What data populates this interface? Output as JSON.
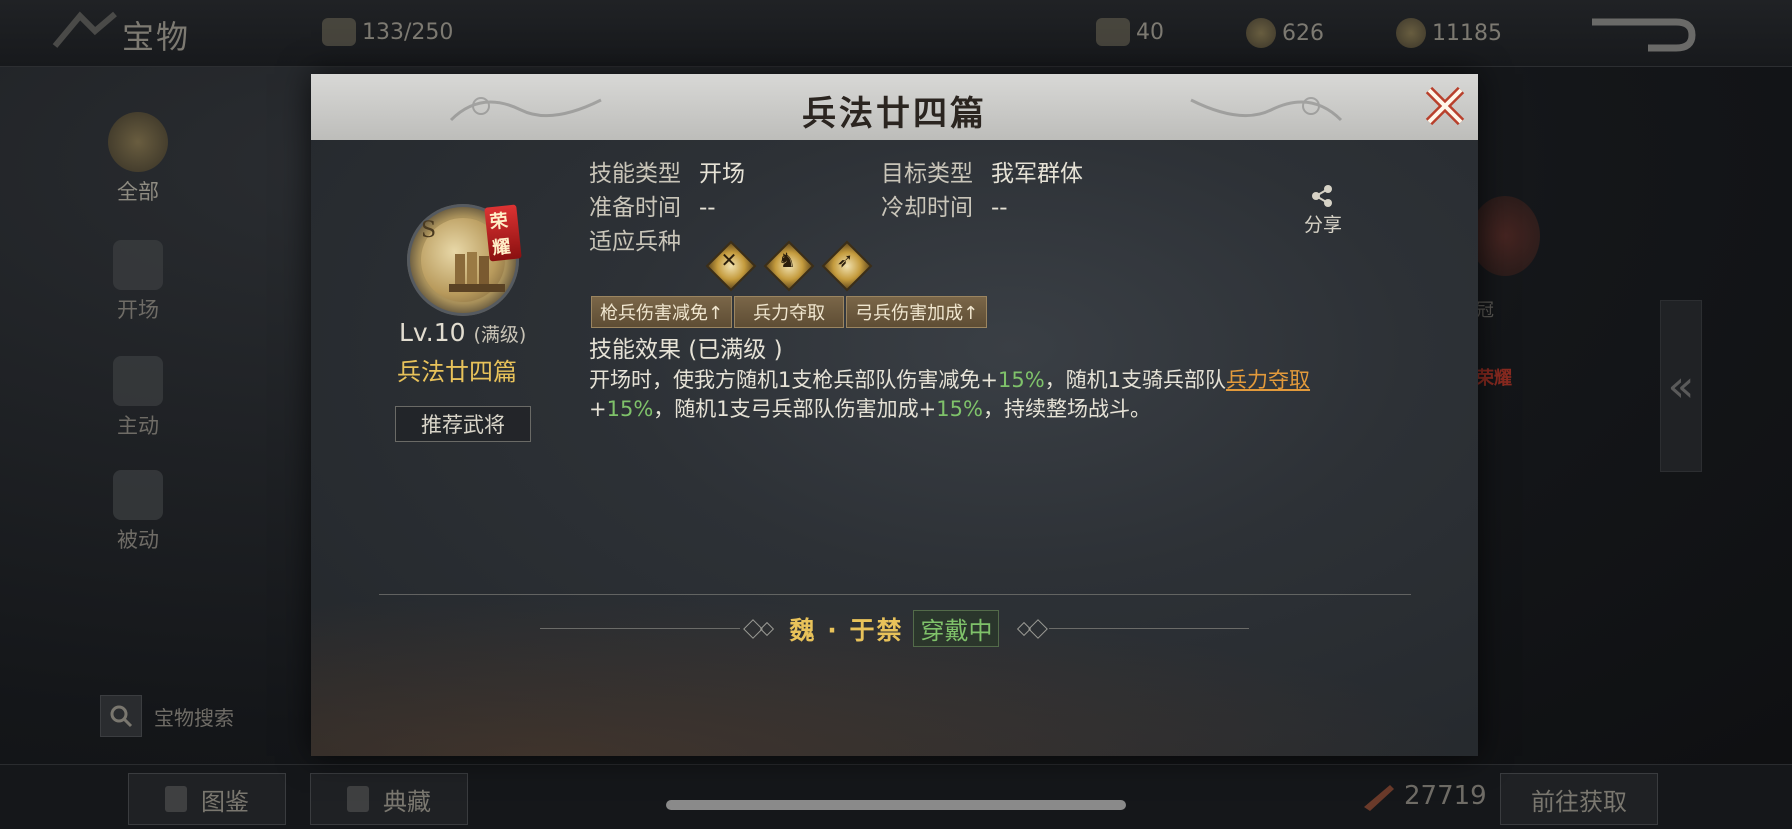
{
  "topbar": {
    "title": "宝物",
    "capacity": "133/250",
    "res1": "40",
    "res2": "626",
    "res3": "11185"
  },
  "sidebar": {
    "items": [
      {
        "label": "全部"
      },
      {
        "label": "开场"
      },
      {
        "label": "主动"
      },
      {
        "label": "被动"
      }
    ],
    "search_label": "宝物搜索"
  },
  "bottombar": {
    "btn_catalog": "图鉴",
    "btn_collection": "典藏",
    "count": "27719",
    "btn_goto": "前往获取"
  },
  "background": {
    "ghost_text_1": "冠",
    "ghost_glory": "荣耀"
  },
  "modal": {
    "title": "兵法廿四篇",
    "skill": {
      "grade": "S",
      "glory_badge": "荣耀",
      "level": "Lv.10",
      "level_note": "(满级)",
      "name": "兵法廿四篇",
      "recommend_label": "推荐武将"
    },
    "attrs": {
      "skill_type_key": "技能类型",
      "skill_type_val": "开场",
      "target_type_key": "目标类型",
      "target_type_val": "我军群体",
      "prep_time_key": "准备时间",
      "prep_time_val": "--",
      "cooldown_key": "冷却时间",
      "cooldown_val": "--",
      "troop_key": "适应兵种"
    },
    "share_label": "分享",
    "troops": [
      {
        "icon": "spear-icon"
      },
      {
        "icon": "horse-icon"
      },
      {
        "icon": "bow-icon"
      }
    ],
    "tags": [
      "枪兵伤害减免↑",
      "兵力夺取",
      "弓兵伤害加成↑"
    ],
    "effect_title": "技能效果 (已满级 )",
    "effect": {
      "p1": "开场时，使我方随机1支枪兵部队伤害减免+",
      "v1": "15%",
      "p2": "，随机1支骑兵部队",
      "link": "兵力夺取",
      "p3": "+",
      "v2": "15%",
      "p4": "，随机1支弓兵部队伤害加成+",
      "v3": "15%",
      "p5": "，持续整场战斗。"
    },
    "general": "魏 · 于禁",
    "wearing": "穿戴中"
  },
  "colors": {
    "gold": "#e8c25a",
    "green": "#7fc26a",
    "orange_link": "#e39a3b"
  }
}
